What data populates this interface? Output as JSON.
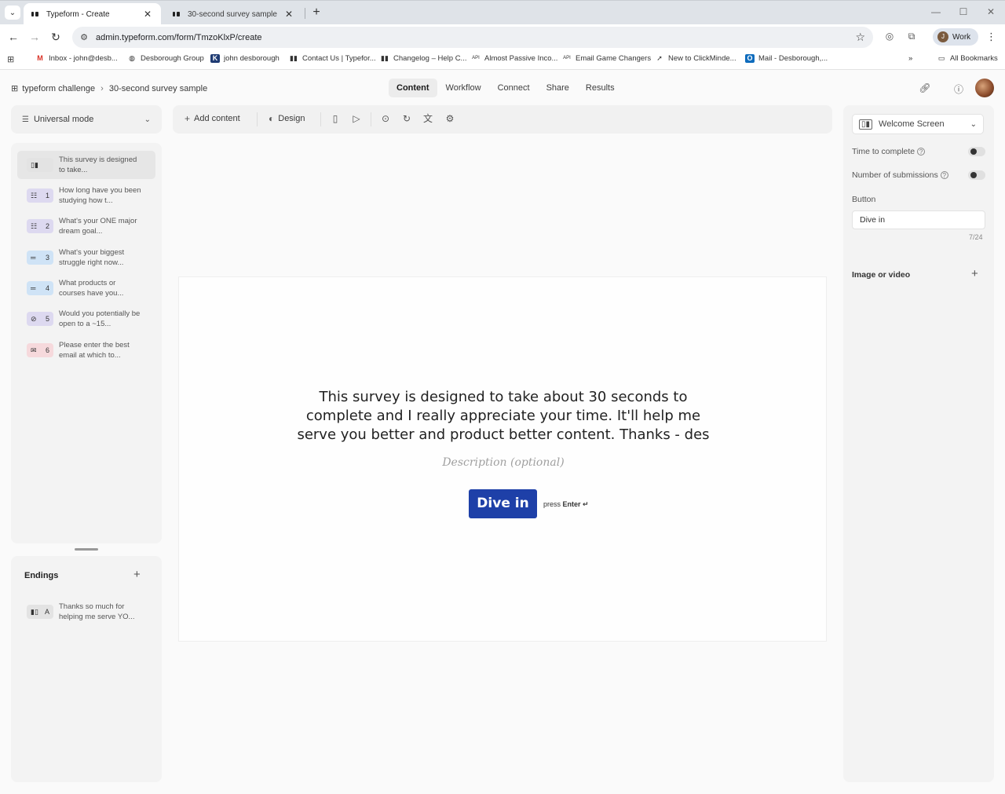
{
  "browser": {
    "tabs": [
      {
        "title": "Typeform - Create",
        "active": true
      },
      {
        "title": "30-second survey sample",
        "active": false
      }
    ],
    "url": "admin.typeform.com/form/TmzoKlxP/create",
    "profile_label": "Work",
    "profile_initial": "J",
    "bookmarks": [
      {
        "label": "Inbox - john@desb...",
        "icon": "gmail-icon"
      },
      {
        "label": "Desborough Group",
        "icon": "globe-icon"
      },
      {
        "label": "john desborough",
        "icon": "k-logo-icon"
      },
      {
        "label": "Contact Us | Typefor...",
        "icon": "typeform-icon"
      },
      {
        "label": "Changelog – Help C...",
        "icon": "typeform-icon"
      },
      {
        "label": "Almost Passive Inco...",
        "icon": "api-icon"
      },
      {
        "label": "Email Game Changers",
        "icon": "api-icon"
      },
      {
        "label": "New to ClickMinde...",
        "icon": "cursor-icon"
      },
      {
        "label": "Mail - Desborough,...",
        "icon": "outlook-icon"
      }
    ],
    "all_bookmarks_label": "All Bookmarks"
  },
  "header": {
    "workspace": "typeform challenge",
    "form_name": "30-second survey sample",
    "nav": [
      "Content",
      "Workflow",
      "Connect",
      "Share",
      "Results"
    ],
    "active_nav": "Content"
  },
  "left": {
    "mode_label": "Universal mode",
    "questions": [
      {
        "num": "",
        "text": "This survey is designed to take...",
        "badge_color": "#e3e3e3",
        "icon": "welcome-screen-icon"
      },
      {
        "num": "1",
        "text": "How long have you been studying how t...",
        "badge_color": "#ddd9f0",
        "icon": "multiple-choice-icon"
      },
      {
        "num": "2",
        "text": "What's your ONE major dream goal...",
        "badge_color": "#ddd9f0",
        "icon": "multiple-choice-icon"
      },
      {
        "num": "3",
        "text": "What's your biggest struggle right now...",
        "badge_color": "#cfe3f6",
        "icon": "short-text-icon"
      },
      {
        "num": "4",
        "text": "What products or courses have you...",
        "badge_color": "#cfe3f6",
        "icon": "short-text-icon"
      },
      {
        "num": "5",
        "text": "Would you potentially be open to a ~15...",
        "badge_color": "#ddd9f0",
        "icon": "no-icon"
      },
      {
        "num": "6",
        "text": "Please enter the best email at which to...",
        "badge_color": "#f6d9dc",
        "icon": "email-icon"
      }
    ],
    "endings_title": "Endings",
    "endings": [
      {
        "letter": "A",
        "text": "Thanks so much for helping me serve YO..."
      }
    ]
  },
  "toolbar": {
    "add_content": "Add content",
    "design": "Design"
  },
  "canvas": {
    "title": "This survey is designed to take about 30 seconds to complete and I really appreciate your time. It'll help me serve you better and product better content. Thanks - des",
    "description_placeholder": "Description (optional)",
    "button_label": "Dive in",
    "hint_press": "press",
    "hint_key": "Enter ↵",
    "button_color": "#1e40a8"
  },
  "right": {
    "screen_type": "Welcome Screen",
    "time_to_complete": "Time to complete",
    "time_to_complete_on": false,
    "num_submissions": "Number of submissions",
    "num_submissions_on": false,
    "button_section": "Button",
    "button_value": "Dive in",
    "char_count": "7/24",
    "image_or_video": "Image or video"
  }
}
